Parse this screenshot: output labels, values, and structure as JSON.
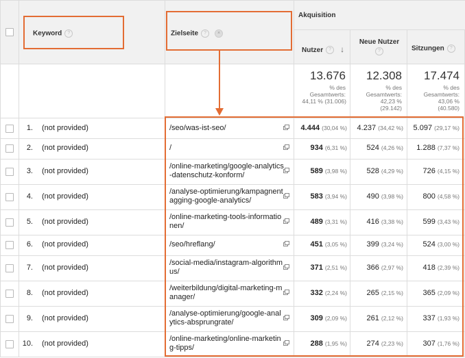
{
  "header": {
    "keyword_label": "Keyword",
    "landing_page_label": "Zielseite",
    "group_label": "Akquisition",
    "users_label": "Nutzer",
    "new_users_label": "Neue Nutzer",
    "sessions_label": "Sitzungen",
    "help_glyph": "?",
    "remove_glyph": "×",
    "sort_glyph": "↓"
  },
  "totals": {
    "users": {
      "value": "13.676",
      "line1": "% des",
      "line2": "Gesamtwerts:",
      "line3": "44,11 % (31.006)"
    },
    "new_users": {
      "value": "12.308",
      "line1": "% des",
      "line2": "Gesamtwerts:",
      "line3": "42,23 %",
      "line4": "(29.142)"
    },
    "sessions": {
      "value": "17.474",
      "line1": "% des",
      "line2": "Gesamtwerts:",
      "line3": "43,06 %",
      "line4": "(40.580)"
    }
  },
  "rows": [
    {
      "rank": "1.",
      "keyword": "(not provided)",
      "page": "/seo/was-ist-seo/",
      "users": "4.444",
      "users_pct": "(30,04 %)",
      "new_users": "4.237",
      "new_users_pct": "(34,42 %)",
      "sessions": "5.097",
      "sessions_pct": "(29,17 %)"
    },
    {
      "rank": "2.",
      "keyword": "(not provided)",
      "page": "/",
      "users": "934",
      "users_pct": "(6,31 %)",
      "new_users": "524",
      "new_users_pct": "(4,26 %)",
      "sessions": "1.288",
      "sessions_pct": "(7,37 %)"
    },
    {
      "rank": "3.",
      "keyword": "(not provided)",
      "page": "/online-marketing/google-analytics-datenschutz-konform/",
      "users": "589",
      "users_pct": "(3,98 %)",
      "new_users": "528",
      "new_users_pct": "(4,29 %)",
      "sessions": "726",
      "sessions_pct": "(4,15 %)"
    },
    {
      "rank": "4.",
      "keyword": "(not provided)",
      "page": "/analyse-optimierung/kampagnentagging-google-analytics/",
      "users": "583",
      "users_pct": "(3,94 %)",
      "new_users": "490",
      "new_users_pct": "(3,98 %)",
      "sessions": "800",
      "sessions_pct": "(4,58 %)"
    },
    {
      "rank": "5.",
      "keyword": "(not provided)",
      "page": "/online-marketing-tools-informationen/",
      "users": "489",
      "users_pct": "(3,31 %)",
      "new_users": "416",
      "new_users_pct": "(3,38 %)",
      "sessions": "599",
      "sessions_pct": "(3,43 %)"
    },
    {
      "rank": "6.",
      "keyword": "(not provided)",
      "page": "/seo/hreflang/",
      "users": "451",
      "users_pct": "(3,05 %)",
      "new_users": "399",
      "new_users_pct": "(3,24 %)",
      "sessions": "524",
      "sessions_pct": "(3,00 %)"
    },
    {
      "rank": "7.",
      "keyword": "(not provided)",
      "page": "/social-media/instagram-algorithmus/",
      "users": "371",
      "users_pct": "(2,51 %)",
      "new_users": "366",
      "new_users_pct": "(2,97 %)",
      "sessions": "418",
      "sessions_pct": "(2,39 %)"
    },
    {
      "rank": "8.",
      "keyword": "(not provided)",
      "page": "/weiterbildung/digital-marketing-manager/",
      "users": "332",
      "users_pct": "(2,24 %)",
      "new_users": "265",
      "new_users_pct": "(2,15 %)",
      "sessions": "365",
      "sessions_pct": "(2,09 %)"
    },
    {
      "rank": "9.",
      "keyword": "(not provided)",
      "page": "/analyse-optimierung/google-analytics-absprungrate/",
      "users": "309",
      "users_pct": "(2,09 %)",
      "new_users": "261",
      "new_users_pct": "(2,12 %)",
      "sessions": "337",
      "sessions_pct": "(1,93 %)"
    },
    {
      "rank": "10.",
      "keyword": "(not provided)",
      "page": "/online-marketing/online-marketing-tipps/",
      "users": "288",
      "users_pct": "(1,95 %)",
      "new_users": "274",
      "new_users_pct": "(2,23 %)",
      "sessions": "307",
      "sessions_pct": "(1,76 %)"
    }
  ],
  "colors": {
    "highlight": "#e36c33",
    "header_bg": "#f1f1f1",
    "grid": "#dcdcdc"
  }
}
